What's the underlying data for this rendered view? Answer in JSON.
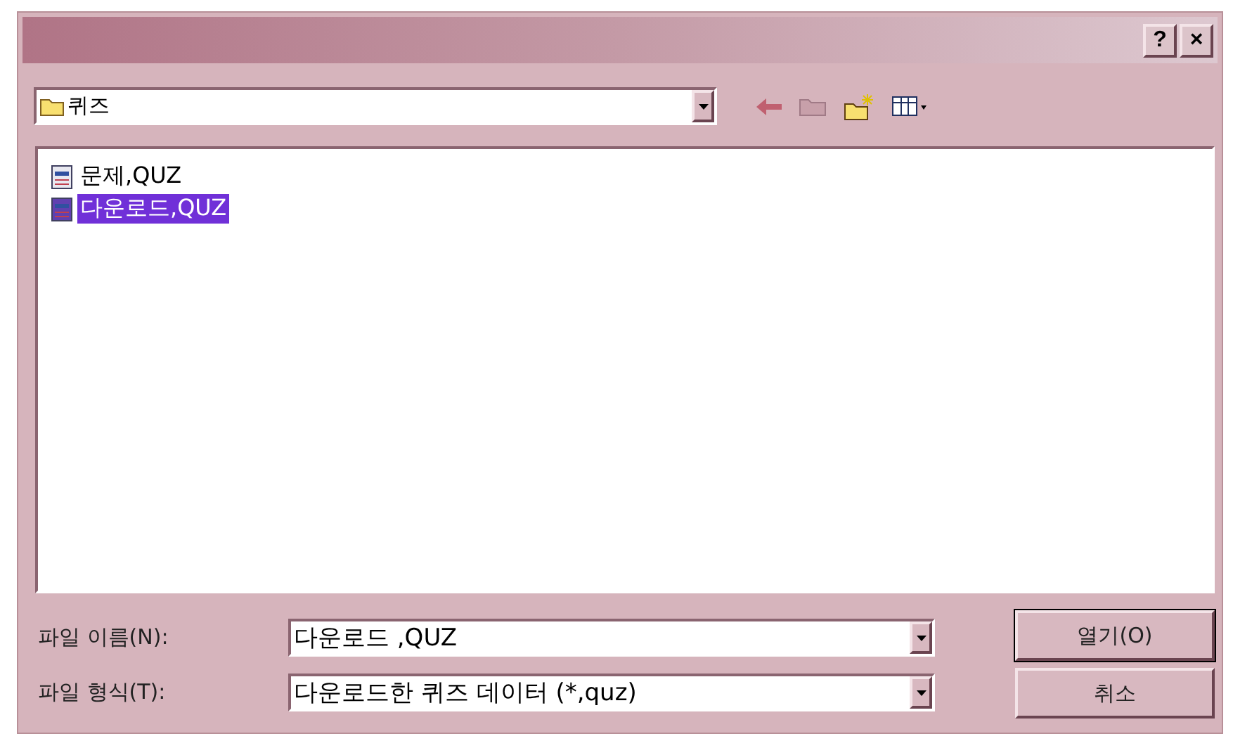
{
  "window": {
    "help_button": "?",
    "close_button": "×"
  },
  "location": {
    "value": "퀴즈"
  },
  "files": [
    {
      "name": "문제,QUZ",
      "selected": false
    },
    {
      "name": "다운로드,QUZ",
      "selected": true
    }
  ],
  "fields": [
    {
      "label": "파일 이름(N):",
      "value": "다운로드 ,QUZ"
    },
    {
      "label": "파일 형식(T):",
      "value": "다운로드한 퀴즈 데이터 (*,quz)"
    }
  ],
  "buttons": [
    "열기(O)",
    "취소"
  ]
}
